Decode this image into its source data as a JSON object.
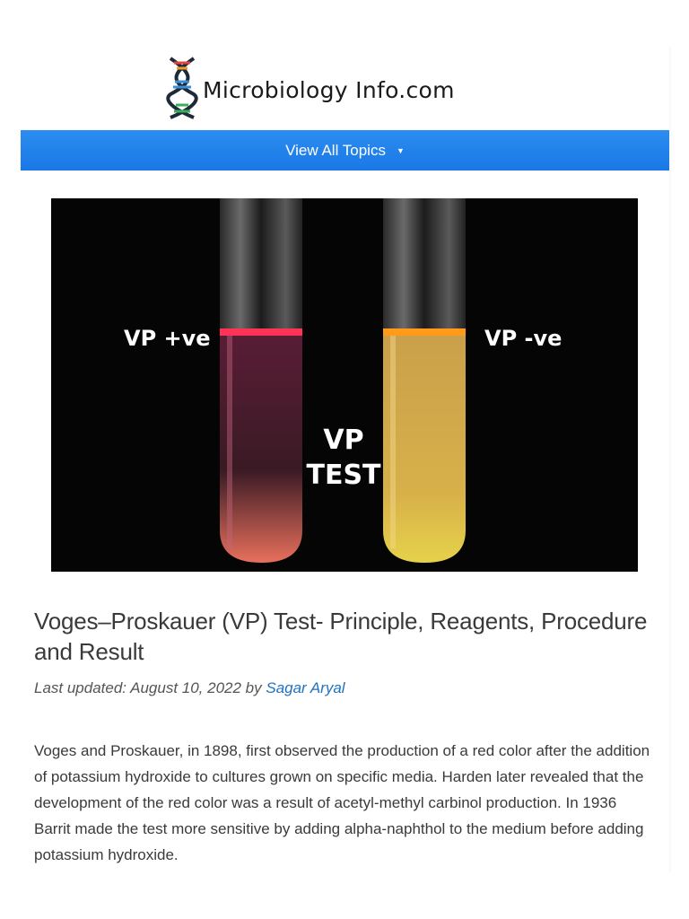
{
  "header": {
    "logo_text": "Microbiology Info.com",
    "nav_label": "View All Topics",
    "nav_caret": "▼"
  },
  "hero": {
    "label_positive": "VP +ve",
    "label_negative": "VP -ve",
    "label_center_1": "VP",
    "label_center_2": "TEST"
  },
  "article": {
    "title": "Voges–Proskauer (VP) Test- Principle, Reagents, Procedure and Result",
    "meta_prefix": "Last updated: August 10, 2022 by ",
    "author": "Sagar Aryal",
    "paragraph": "Voges and Proskauer, in 1898, first observed the production of a red color after the addition of potassium hydroxide to cultures grown on specific media. Harden later revealed that the development of the red color was a result of acetyl-methyl carbinol production. In 1936 Barrit made the test more sensitive by adding alpha-naphthol to the medium before adding potassium hydroxide."
  },
  "colors": {
    "nav_blue": "#1a78e6",
    "link_blue": "#1e73be",
    "positive_red": "#ff3355",
    "negative_orange": "#ff9a1a"
  }
}
